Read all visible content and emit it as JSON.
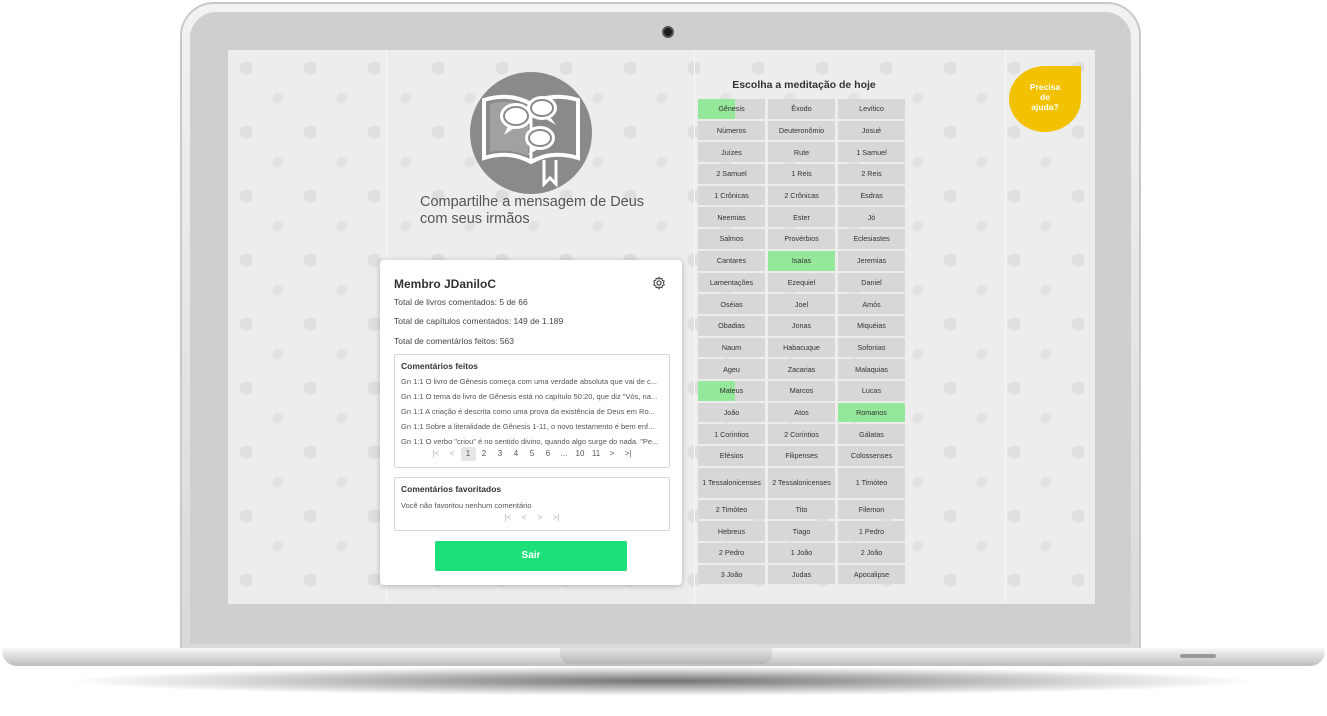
{
  "hero": {
    "tagline_line1": "Compartilhe a mensagem de Deus",
    "tagline_line2": "com seus irmãos"
  },
  "profile": {
    "title": "Membro JDaniloC",
    "stats": [
      "Total de livros comentados: 5 de 66",
      "Total de capítulos comentados: 149 de 1.189",
      "Total de comentários feitos: 563"
    ],
    "comments_title": "Comentários feitos",
    "comments": [
      "Gn 1:1 O livro de Gênesis começa com uma verdade absoluta que vai de c...",
      "Gn 1:1 O tema do livro de Gênesis está no capítulo 50:20, que diz \"Vós, na...",
      "Gn 1:1 A criação é descrita como uma prova da existência de Deus em Ro...",
      "Gn 1:1 Sobre a literalidade de Gênesis 1-11, o novo testamento é bem enf...",
      "Gn 1:1 O verbo \"criou\" é no sentido divino, quando algo surge do nada. \"Pe..."
    ],
    "pager": {
      "first": "|<",
      "prev": "<",
      "pages": [
        "1",
        "2",
        "3",
        "4",
        "5",
        "6",
        "...",
        "10",
        "11"
      ],
      "next": ">",
      "last": ">|",
      "current": "1"
    },
    "favorites_title": "Comentários favoritados",
    "favorites_empty": "Você não favoritou nenhum comentário",
    "logout_label": "Sair"
  },
  "books_title": "Escolha a meditação de hoje",
  "books": [
    {
      "name": "Gênesis",
      "state": "partial"
    },
    {
      "name": "Êxodo"
    },
    {
      "name": "Levítico"
    },
    {
      "name": "Números"
    },
    {
      "name": "Deuteronômio"
    },
    {
      "name": "Josué"
    },
    {
      "name": "Juízes"
    },
    {
      "name": "Rute"
    },
    {
      "name": "1 Samuel"
    },
    {
      "name": "2 Samuel"
    },
    {
      "name": "1 Reis"
    },
    {
      "name": "2 Reis"
    },
    {
      "name": "1 Crônicas"
    },
    {
      "name": "2 Crônicas"
    },
    {
      "name": "Esdras"
    },
    {
      "name": "Neemias"
    },
    {
      "name": "Ester"
    },
    {
      "name": "Jó"
    },
    {
      "name": "Salmos"
    },
    {
      "name": "Provérbios"
    },
    {
      "name": "Eclesiastes"
    },
    {
      "name": "Cantares"
    },
    {
      "name": "Isaías",
      "state": "done"
    },
    {
      "name": "Jeremias"
    },
    {
      "name": "Lamentações"
    },
    {
      "name": "Ezequiel"
    },
    {
      "name": "Daniel"
    },
    {
      "name": "Oséias"
    },
    {
      "name": "Joel"
    },
    {
      "name": "Amós"
    },
    {
      "name": "Obadias"
    },
    {
      "name": "Jonas"
    },
    {
      "name": "Miquéias"
    },
    {
      "name": "Naum"
    },
    {
      "name": "Habacuque"
    },
    {
      "name": "Sofonias"
    },
    {
      "name": "Ageu"
    },
    {
      "name": "Zacarias"
    },
    {
      "name": "Malaquias"
    },
    {
      "name": "Mateus",
      "state": "partial"
    },
    {
      "name": "Marcos"
    },
    {
      "name": "Lucas"
    },
    {
      "name": "João"
    },
    {
      "name": "Atos"
    },
    {
      "name": "Romanos",
      "state": "done"
    },
    {
      "name": "1 Coríntios"
    },
    {
      "name": "2 Coríntios"
    },
    {
      "name": "Gálatas"
    },
    {
      "name": "Efésios"
    },
    {
      "name": "Filipenses"
    },
    {
      "name": "Colossenses"
    },
    {
      "name": "1 Tessalonicenses"
    },
    {
      "name": "2 Tessalonicenses"
    },
    {
      "name": "1 Timóteo"
    },
    {
      "name": "2 Timóteo"
    },
    {
      "name": "Tito"
    },
    {
      "name": "Filemon"
    },
    {
      "name": "Hebreus"
    },
    {
      "name": "Tiago"
    },
    {
      "name": "1 Pedro"
    },
    {
      "name": "2 Pedro"
    },
    {
      "name": "1 João"
    },
    {
      "name": "2 João"
    },
    {
      "name": "3 João"
    },
    {
      "name": "Judas"
    },
    {
      "name": "Apocalipse"
    }
  ],
  "help_label": {
    "line1": "Precisa",
    "line2": "de",
    "line3": "ajuda?"
  },
  "colors": {
    "accent_green": "#1de07a",
    "book_done": "#95e89a",
    "book_default": "#d7d7d7",
    "help_yellow": "#f2c200"
  }
}
